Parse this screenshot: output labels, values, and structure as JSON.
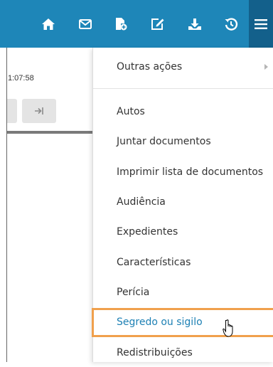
{
  "toolbar": {
    "buttons": [
      {
        "icon": "home-icon"
      },
      {
        "icon": "mail-icon"
      },
      {
        "icon": "new-document-icon"
      },
      {
        "icon": "edit-icon"
      },
      {
        "icon": "download-icon"
      },
      {
        "icon": "history-icon"
      }
    ],
    "menu_icon": "hamburger-icon"
  },
  "panel": {
    "timestamp": "1:07:58"
  },
  "menu": {
    "items": [
      {
        "label": "Outras ações",
        "submenu": true
      },
      {
        "label": "Autos"
      },
      {
        "label": "Juntar documentos"
      },
      {
        "label": "Imprimir lista de documentos"
      },
      {
        "label": "Audiência"
      },
      {
        "label": "Expedientes"
      },
      {
        "label": "Características"
      },
      {
        "label": "Perícia"
      },
      {
        "label": "Segredo ou sigilo",
        "highlighted": true
      },
      {
        "label": "Redistribuições"
      }
    ]
  },
  "colors": {
    "toolbar": "#1e86b8",
    "toolbar_active": "#13608b",
    "highlight_border": "#f0a04c",
    "link_active": "#1d80b4"
  }
}
